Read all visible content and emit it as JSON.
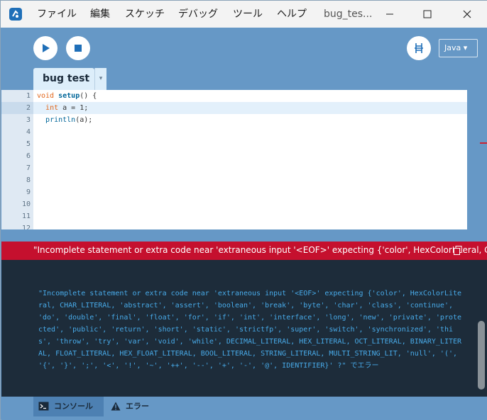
{
  "menu": {
    "items": [
      "ファイル",
      "編集",
      "スケッチ",
      "デバッグ",
      "ツール",
      "ヘルプ"
    ],
    "window_title": "bug_tes..."
  },
  "toolbar": {
    "run_icon": "play-icon",
    "stop_icon": "stop-icon",
    "debug_icon": "debugger-icon",
    "mode": "Java ▾"
  },
  "tabs": [
    {
      "label": "bug test",
      "menu_glyph": "▾"
    }
  ],
  "editor": {
    "line_numbers": [
      "1",
      "2",
      "3",
      "4",
      "5",
      "6",
      "7",
      "8",
      "9",
      "10",
      "11",
      "12"
    ],
    "current_line": "2",
    "lines": [
      {
        "type": "void",
        "name": "setup",
        "rest": "() {"
      },
      {
        "type": "int",
        "rest": " a = 1;"
      },
      {
        "fn": "println",
        "rest": "(a);"
      }
    ]
  },
  "error_bar": {
    "message": "\"Incomplete statement or extra code near 'extraneous input '<EOF>' expecting {'color', HexColorLiteral, CHAR_LITERAL, 'abstract', 'assert', 'boolean', 'break', 'byte', 'char', 'class',"
  },
  "console": {
    "output": "\"Incomplete statement or extra code near  'extraneous input '<EOF>' expecting {'color', HexColorLiteral, CHAR_LITERAL, 'abstract', 'assert', 'boolean', 'break', 'byte', 'char', 'class', 'continue', 'do', 'double', 'final', 'float', 'for', 'if', 'int', 'interface', 'long', 'new', 'private', 'protected', 'public', 'return', 'short', 'static', 'strictfp', 'super', 'switch', 'synchronized', 'this', 'throw', 'try', 'var', 'void', 'while', DECIMAL_LITERAL, HEX_LITERAL, OCT_LITERAL, BINARY_LITERAL, FLOAT_LITERAL, HEX_FLOAT_LITERAL, BOOL_LITERAL, STRING_LITERAL, MULTI_STRING_LIT, 'null', '(', '{', '}', ';', '<', '!', '~', '++', '--', '+', '-', '@', IDENTIFIER}' ?\" でエラー"
  },
  "footer": {
    "console_label": "コンソール",
    "errors_label": "エラー"
  },
  "colors": {
    "accent_blue": "#6698c6",
    "error_red": "#c5102e",
    "console_bg": "#1d2c3a",
    "console_text": "#48aae8"
  }
}
